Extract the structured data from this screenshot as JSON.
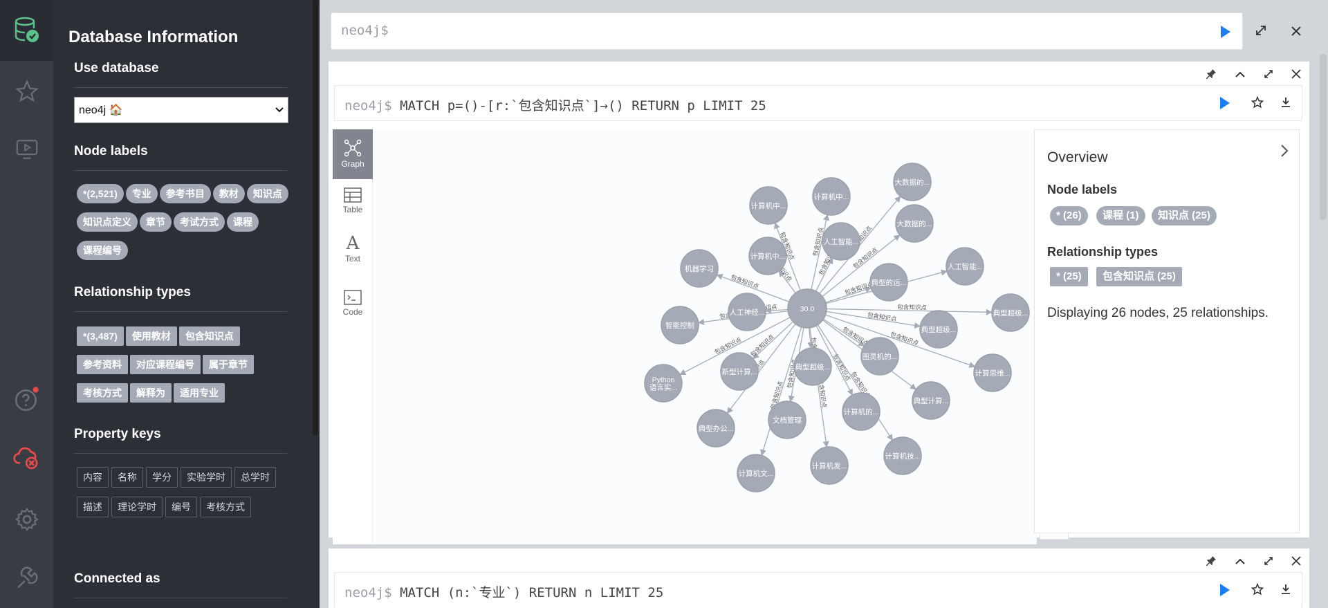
{
  "sidebar": {
    "panel_title": "Database Information",
    "use_database": {
      "heading": "Use database",
      "selected": "neo4j 🏠"
    },
    "node_labels": {
      "heading": "Node labels",
      "items": [
        "*(2,521)",
        "专业",
        "参考书目",
        "教材",
        "知识点",
        "知识点定义",
        "章节",
        "考试方式",
        "课程",
        "课程编号"
      ]
    },
    "relationship_types": {
      "heading": "Relationship types",
      "items": [
        "*(3,487)",
        "使用教材",
        "包含知识点",
        "参考资料",
        "对应课程编号",
        "属于章节",
        "考核方式",
        "解释为",
        "适用专业"
      ]
    },
    "property_keys": {
      "heading": "Property keys",
      "items": [
        "内容",
        "名称",
        "学分",
        "实验学时",
        "总学时",
        "描述",
        "理论学时",
        "编号",
        "考核方式"
      ]
    },
    "connected_as": {
      "heading": "Connected as"
    }
  },
  "icons": [
    "database-icon",
    "star-icon",
    "play-icon",
    "help-icon",
    "cloud-error-icon",
    "settings-icon",
    "plugin-icon"
  ],
  "colors": {
    "node": "#a5abb6",
    "sidebar": "#2d2f36",
    "play": "#1b7ff0"
  },
  "editor": {
    "prompt": "neo4j$"
  },
  "frame1": {
    "prompt": "neo4j$",
    "query": "MATCH p=()-[r:`包含知识点`]→() RETURN p LIMIT 25",
    "tabs": [
      "Graph",
      "Table",
      "Text",
      "Code"
    ],
    "overview": {
      "title": "Overview",
      "node_labels_heading": "Node labels",
      "node_labels": [
        "* (26)",
        "课程 (1)",
        "知识点 (25)"
      ],
      "rel_heading": "Relationship types",
      "rel_types": [
        "* (25)",
        "包含知识点 (25)"
      ],
      "summary": "Displaying 26 nodes, 25 relationships."
    },
    "graph": {
      "center": "30.0",
      "rel_label": "包含知识点",
      "nodes": [
        "计算机中...",
        "计算机中...",
        "大数据的...",
        "大数据的...",
        "人工智能...",
        "计算机中...",
        "人工智能...",
        "机器学习",
        "典型的运...",
        "智能控制",
        "人工神经...",
        "典型超级...",
        "典型超级...",
        "图灵机的...",
        "计算思维...",
        "Python语言实...",
        "新型计算...",
        "典型超级...",
        "典型计算...",
        "典型办公...",
        "文档管理",
        "计算机的...",
        "计算机技...",
        "计算机文...",
        "计算机发..."
      ]
    }
  },
  "frame2": {
    "prompt": "neo4j$",
    "query": "MATCH (n:`专业`) RETURN n LIMIT 25"
  }
}
